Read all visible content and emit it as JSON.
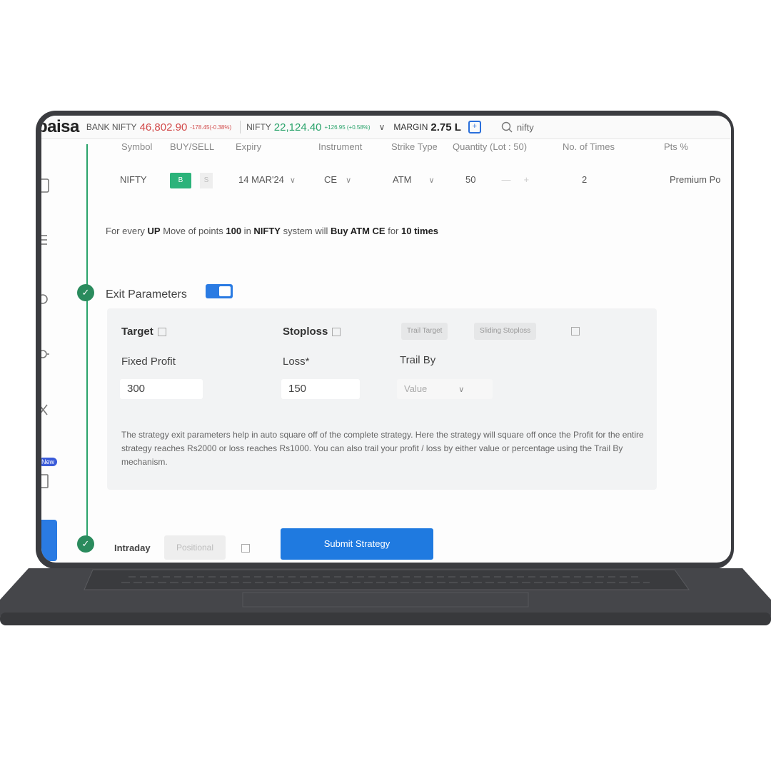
{
  "topbar": {
    "logo": "paisa",
    "bank_nifty_label": "BANK NIFTY",
    "bank_nifty_value": "46,802.90",
    "bank_nifty_change": "-178.45(-0.38%)",
    "nifty_label": "NIFTY",
    "nifty_value": "22,124.40",
    "nifty_change": "+126.95 (+0.58%)",
    "margin_label": "MARGIN",
    "margin_value": "2.75 L",
    "search_value": "nifty"
  },
  "sidebar": {
    "new_badge": "New"
  },
  "table": {
    "headers": [
      "Symbol",
      "BUY/SELL",
      "Expiry",
      "Instrument",
      "Strike Type",
      "Quantity (Lot : 50)",
      "No. of Times",
      "Pts %"
    ],
    "row": {
      "symbol": "NIFTY",
      "buy": "B",
      "sell": "S",
      "expiry": "14 MAR'24",
      "instrument": "CE",
      "strike_type": "ATM",
      "quantity": "50",
      "times": "2",
      "premium": "Premium Po"
    }
  },
  "summary": {
    "p1": "For every ",
    "p2": "UP",
    "p3": " Move of points ",
    "p4": "100",
    "p5": " in ",
    "p6": "NIFTY",
    "p7": " system will ",
    "p8": "Buy ATM CE",
    "p9": " for ",
    "p10": "10 times"
  },
  "exit": {
    "title": "Exit Parameters",
    "target_label": "Target",
    "stoploss_label": "Stoploss",
    "trail_target": "Trail Target",
    "sliding_stoploss": "Sliding Stoploss",
    "fixed_profit_label": "Fixed Profit",
    "fixed_profit_value": "300",
    "loss_label": "Loss*",
    "loss_value": "150",
    "trail_by_label": "Trail By",
    "trail_by_value": "Value",
    "description": "The strategy exit parameters help in auto square off of the complete strategy. Here the strategy will square off once the Profit for the entire strategy reaches Rs2000 or loss reaches Rs1000. You can also trail your profit / loss by either value or percentage using the Trail By mechanism."
  },
  "footer": {
    "intraday": "Intraday",
    "positional": "Positional",
    "submit": "Submit Strategy"
  },
  "colors": {
    "accent": "#1f7ae0",
    "green": "#2aa36b",
    "red": "#d24a4a",
    "laptop": "#3b3c40"
  }
}
